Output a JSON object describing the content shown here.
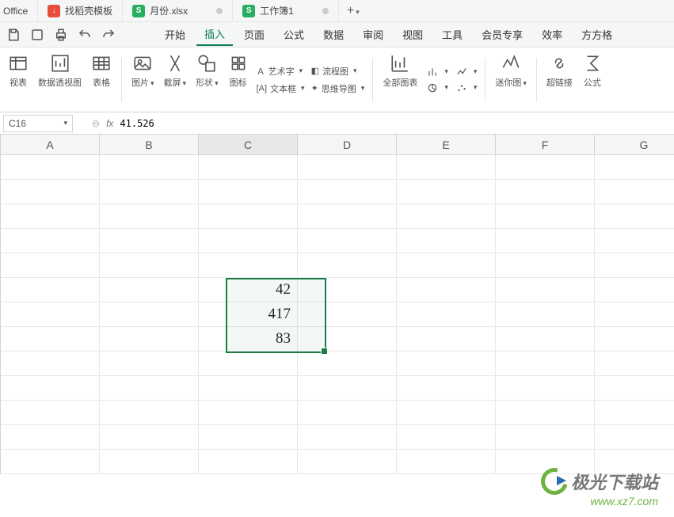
{
  "tabs": {
    "office": "Office",
    "docker": "找稻壳模板",
    "file1": "月份.xlsx",
    "file2": "工作簿1"
  },
  "menu": {
    "start": "开始",
    "insert": "插入",
    "page": "页面",
    "formula": "公式",
    "data": "数据",
    "review": "审阅",
    "view": "视图",
    "tools": "工具",
    "member": "会员专享",
    "efficiency": "效率",
    "square": "方方格"
  },
  "ribbon": {
    "pivot_table_short": "视表",
    "pivot_chart": "数据透视图",
    "table": "表格",
    "picture": "图片",
    "screenshot": "截屏",
    "shapes": "形状",
    "icons": "图标",
    "wordart": "艺术字",
    "textbox": "文本框",
    "flowchart": "流程图",
    "mindmap": "思维导图",
    "all_charts": "全部图表",
    "sparkline": "迷你图",
    "hyperlink": "超链接",
    "formula_symbol": "公式"
  },
  "name_box": "C16",
  "formula_value": "41.526",
  "columns": [
    "A",
    "B",
    "C",
    "D",
    "E",
    "F",
    "G"
  ],
  "cells": {
    "c6": "42",
    "c7": "417",
    "c8": "83"
  },
  "watermark": {
    "title": "极光下载站",
    "url": "www.xz7.com"
  }
}
